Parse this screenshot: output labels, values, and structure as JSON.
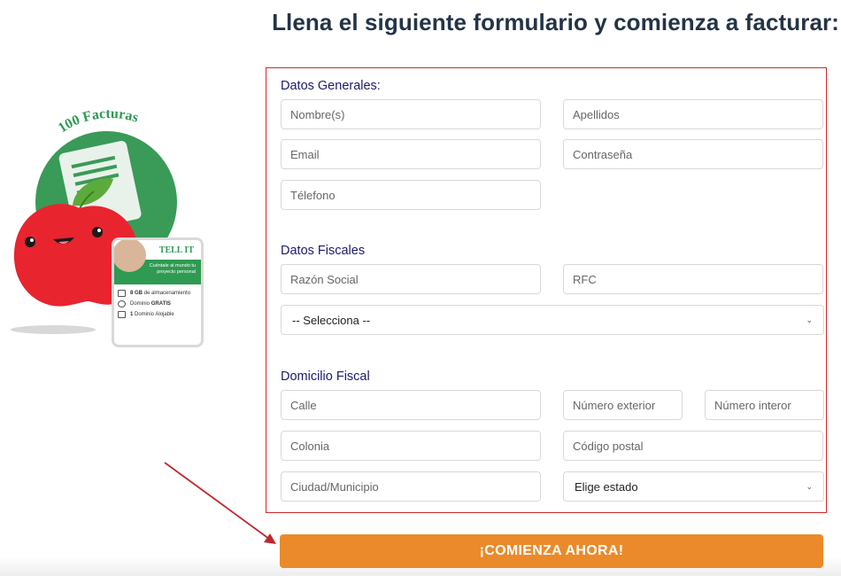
{
  "page": {
    "heading": "Llena el siguiente formulario y comienza a facturar:"
  },
  "illustration": {
    "badge_text": "100 Facturas",
    "card": {
      "title": "TELL IT",
      "subtitle": "Cuéntale al mundo tu proyecto personal",
      "features": [
        {
          "bold": "8 GB",
          "text": "de almacenamiento"
        },
        {
          "bold": "GRATIS",
          "text": "Dominio"
        },
        {
          "bold": "1",
          "text": "Dominio Alojable"
        }
      ]
    }
  },
  "form": {
    "general": {
      "title": "Datos Generales:",
      "nombre_placeholder": "Nombre(s)",
      "apellidos_placeholder": "Apellidos",
      "email_placeholder": "Email",
      "password_placeholder": "Contraseña",
      "telefono_placeholder": "Télefono"
    },
    "fiscal": {
      "title": "Datos Fiscales",
      "razon_social_placeholder": "Razón Social",
      "rfc_placeholder": "RFC",
      "regimen_selected": "-- Selecciona --"
    },
    "domicilio": {
      "title": "Domicilio Fiscal",
      "calle_placeholder": "Calle",
      "num_ext_placeholder": "Número exterior",
      "num_int_placeholder": "Número interor",
      "colonia_placeholder": "Colonia",
      "cp_placeholder": "Código postal",
      "ciudad_placeholder": "Ciudad/Municipio",
      "estado_selected": "Elige estado"
    },
    "submit_label": "¡COMIENZA AHORA!"
  },
  "colors": {
    "accent_orange": "#ea8a2a",
    "form_border": "#cf2a2a",
    "arrow": "#c0272d",
    "brand_green": "#2e9a52",
    "apple_red": "#e8242f"
  }
}
